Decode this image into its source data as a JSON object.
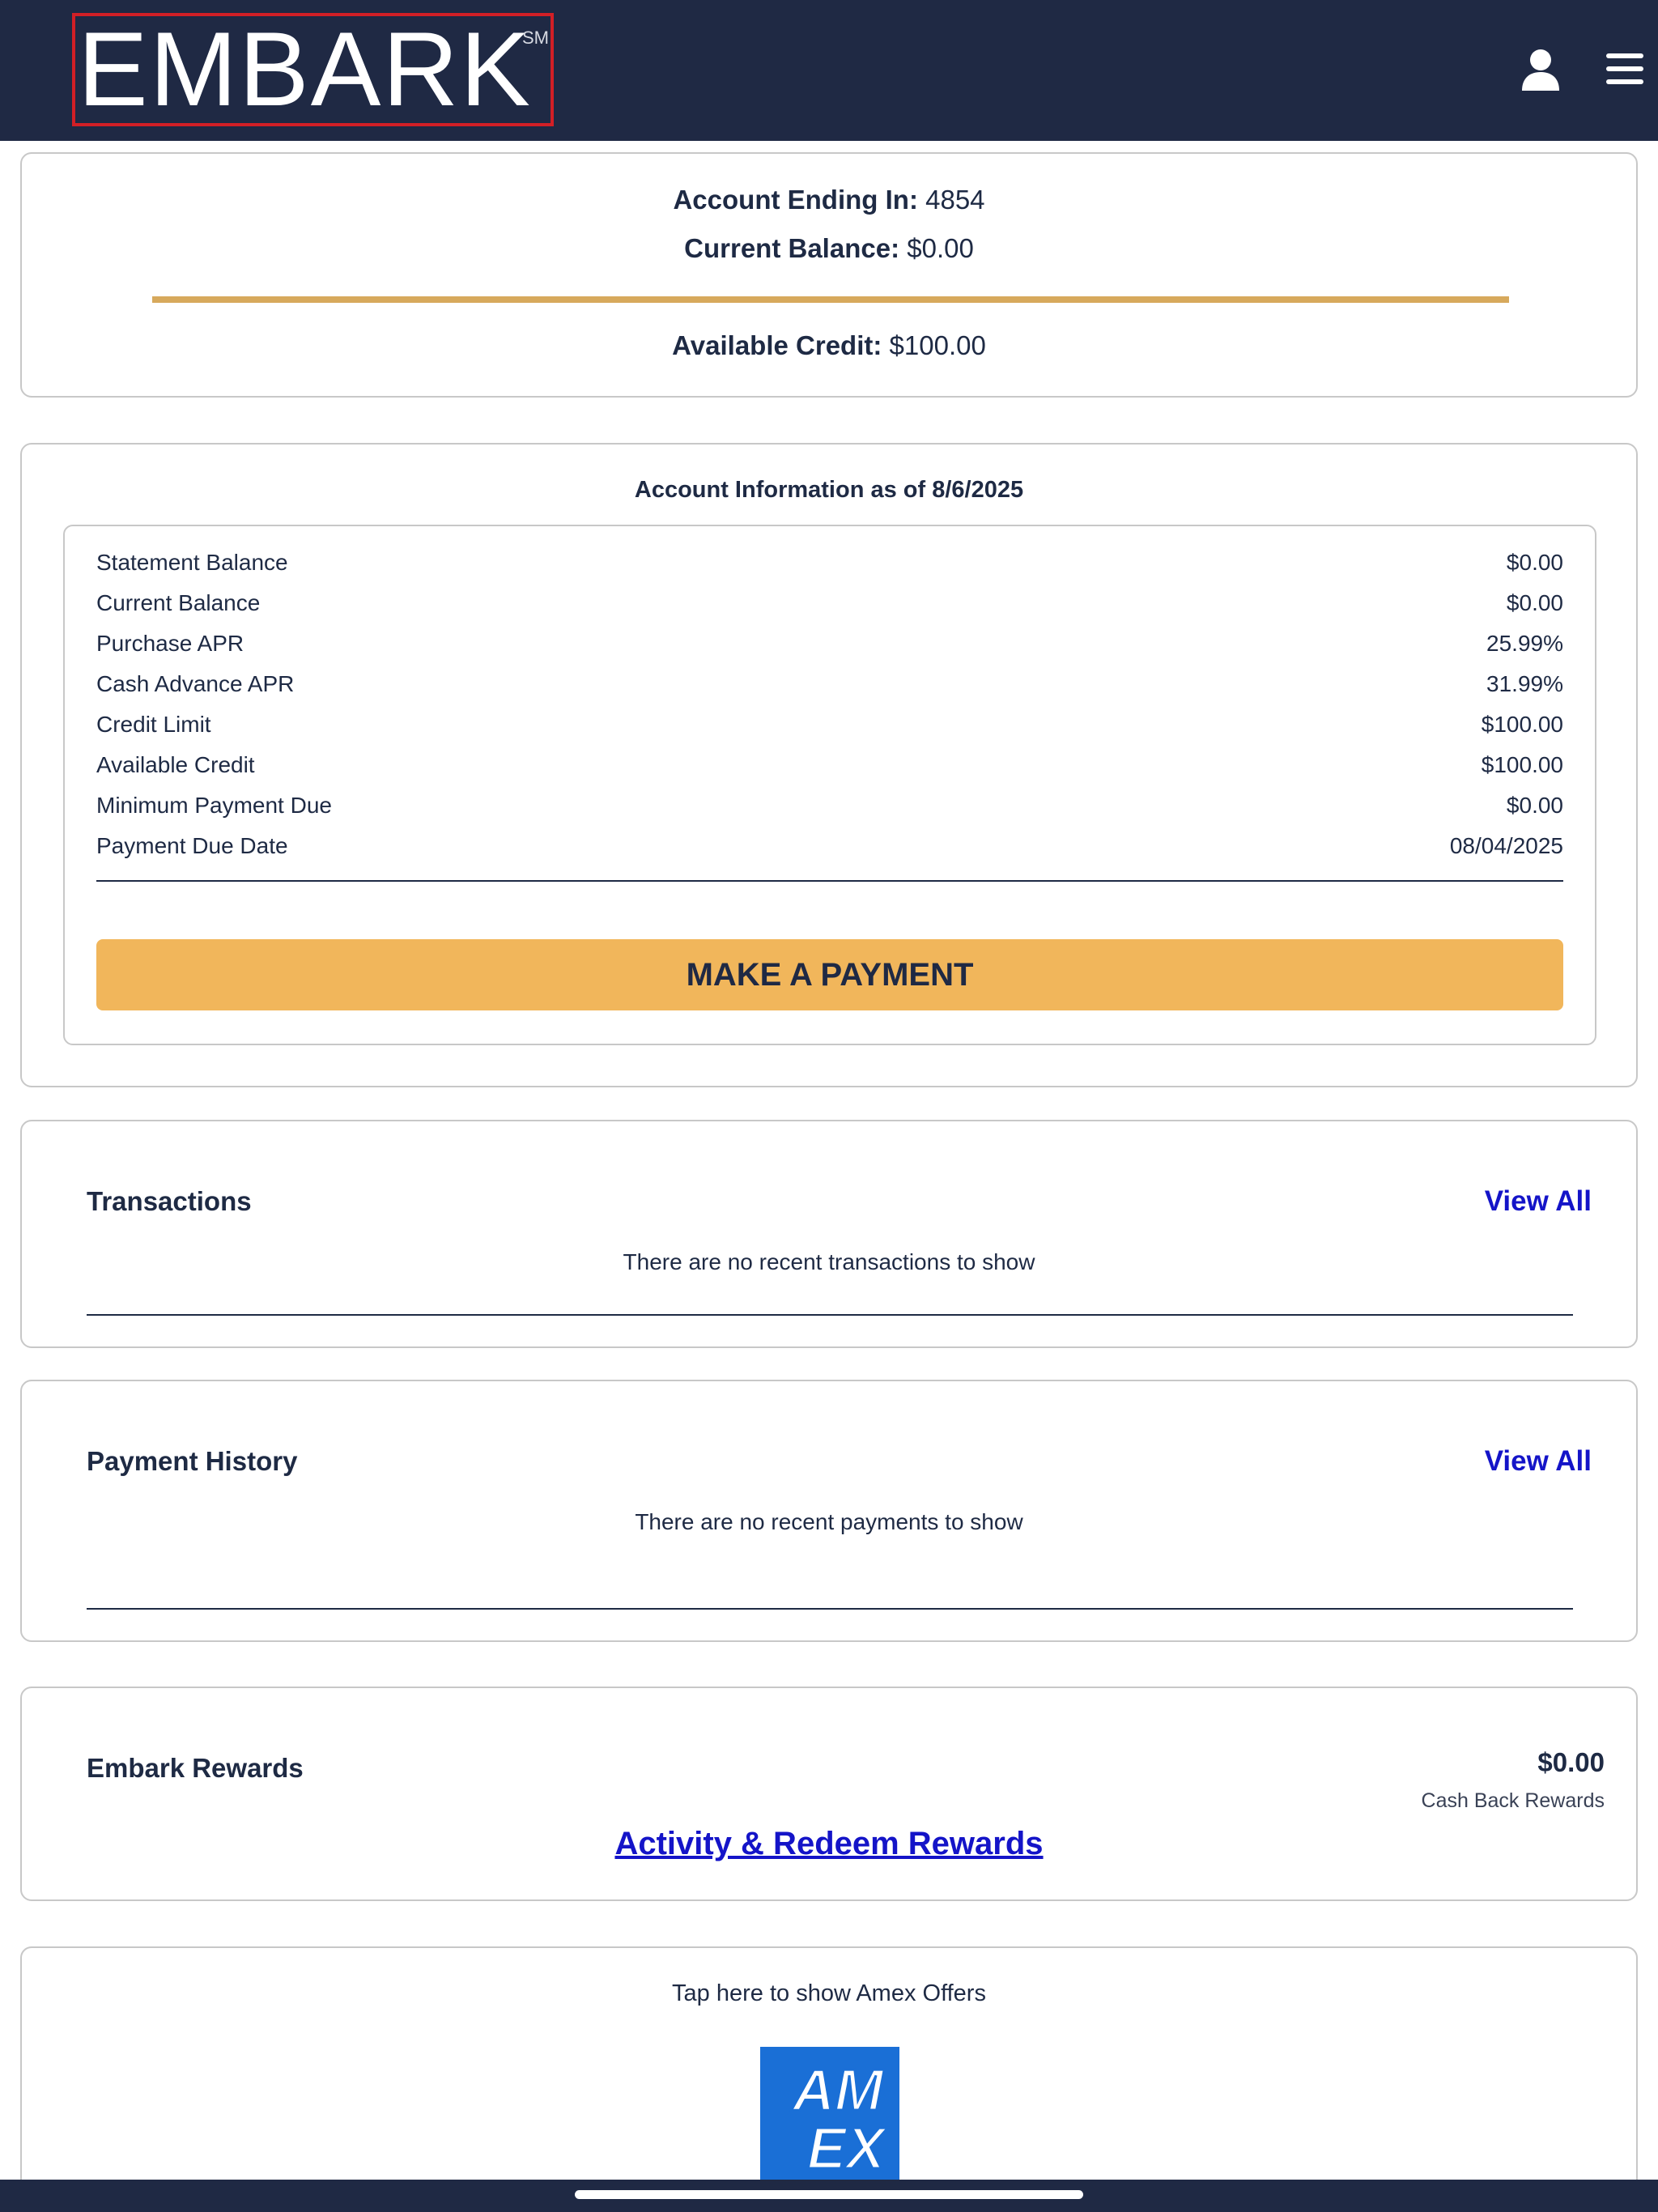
{
  "header": {
    "logo_text": "EMBARK",
    "logo_mark": "SM",
    "icons": [
      "user-icon",
      "menu-icon"
    ]
  },
  "summary": {
    "account_ending_label": "Account Ending In:",
    "account_ending_value": "4854",
    "current_balance_label": "Current Balance:",
    "current_balance_value": "$0.00",
    "available_credit_label": "Available Credit:",
    "available_credit_value": "$100.00"
  },
  "account_info": {
    "title": "Account Information as of 8/6/2025",
    "rows": [
      {
        "label": "Statement Balance",
        "value": "$0.00"
      },
      {
        "label": "Current Balance",
        "value": "$0.00"
      },
      {
        "label": "Purchase APR",
        "value": "25.99%"
      },
      {
        "label": "Cash Advance APR",
        "value": "31.99%"
      },
      {
        "label": "Credit Limit",
        "value": "$100.00"
      },
      {
        "label": "Available Credit",
        "value": "$100.00"
      },
      {
        "label": "Minimum Payment Due",
        "value": "$0.00"
      },
      {
        "label": "Payment Due Date",
        "value": "08/04/2025"
      }
    ],
    "payment_button": "MAKE A PAYMENT"
  },
  "transactions": {
    "title": "Transactions",
    "view_all": "View All",
    "empty_message": "There are no recent transactions to show"
  },
  "payment_history": {
    "title": "Payment History",
    "view_all": "View All",
    "empty_message": "There are no recent payments to show"
  },
  "rewards": {
    "title": "Embark Rewards",
    "amount": "$0.00",
    "amount_label": "Cash Back Rewards",
    "link": "Activity & Redeem Rewards"
  },
  "amex": {
    "prompt": "Tap here to show Amex Offers",
    "logo_line1": "AM",
    "logo_line2": "EX"
  },
  "colors": {
    "header_bg": "#1f2944",
    "accent_gold": "#d7a95c",
    "button_bg": "#f1b65b",
    "link_blue": "#1414c8",
    "amex_blue": "#1a6fd6"
  }
}
